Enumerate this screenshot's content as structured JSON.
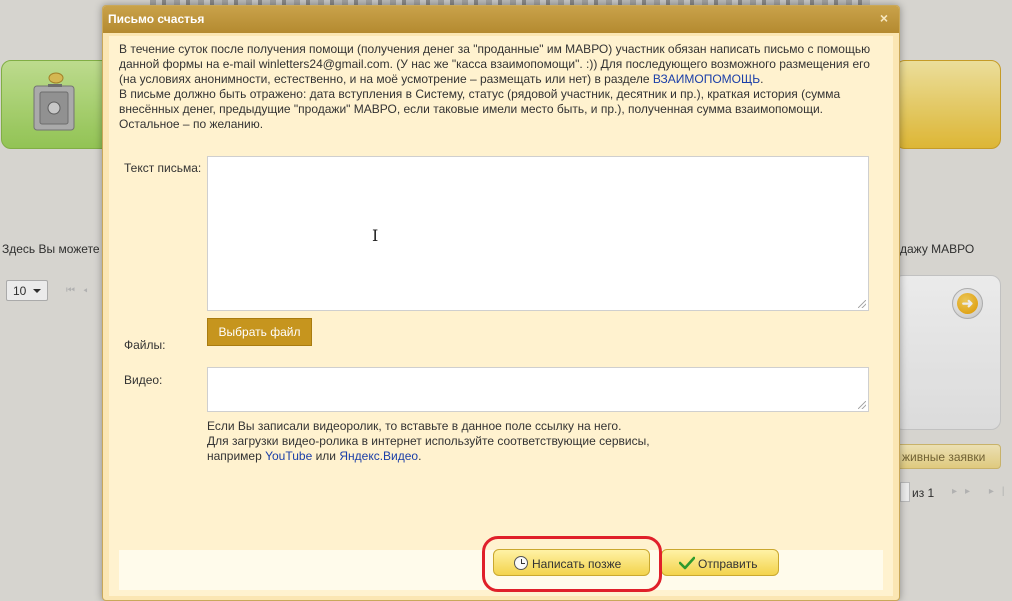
{
  "background": {
    "left_text": "Здесь Вы можете",
    "right_text": "дажу МАВРО",
    "per_page_select": "10",
    "active_requests_button": "живные заявки",
    "pager_of": "из 1"
  },
  "dialog": {
    "title": "Письмо счастья",
    "close_glyph": "×",
    "intro": {
      "p1_pre": "В течение суток после получения помощи (получения денег за \"проданные\" им МАВРО) участник обязан написать письмо с помощью данной формы на e-mail winletters24@gmail.com. (У нас же \"касса взаимопомощи\". :)) Для последующего возможного размещения его (на условиях анонимности, естественно, и на моё усмотрение – размещать или нет) в разделе ",
      "p1_link": "ВЗАИМОПОМОЩЬ",
      "p1_post": ".",
      "p2": "В письме должно быть отражено: дата вступления в Систему, статус (рядовой участник, десятник и пр.), краткая история (сумма внесённых денег, предыдущие \"продажи\" МАВРО, если таковые имели место быть, и пр.), полученная сумма взаимопомощи.",
      "p3": "Остальное – по желанию."
    },
    "form": {
      "letter_label": "Текст письма:",
      "letter_value": "",
      "files_label": "Файлы:",
      "file_button": "Выбрать файл",
      "video_label": "Видео:",
      "video_value": ""
    },
    "video_help": {
      "line1": "Если Вы записали видеоролик, то вставьте в данное поле ссылку на него.",
      "line2": "Для загрузки видео-ролика в интернет используйте соответствующие сервисы,",
      "line3_pre": "например ",
      "youtube": "YouTube",
      "line3_mid": " или ",
      "yandex": "Яндекс.Видео",
      "line3_post": "."
    },
    "footer": {
      "write_later": "Написать позже",
      "send": "Отправить"
    }
  },
  "icons": {
    "write_later": "clock-icon",
    "send": "check-icon",
    "close": "close-icon"
  },
  "colors": {
    "dialog_title": "#b48a30",
    "highlight": "#e0202a",
    "button": "#f3d34c",
    "file_button": "#c6951e"
  }
}
